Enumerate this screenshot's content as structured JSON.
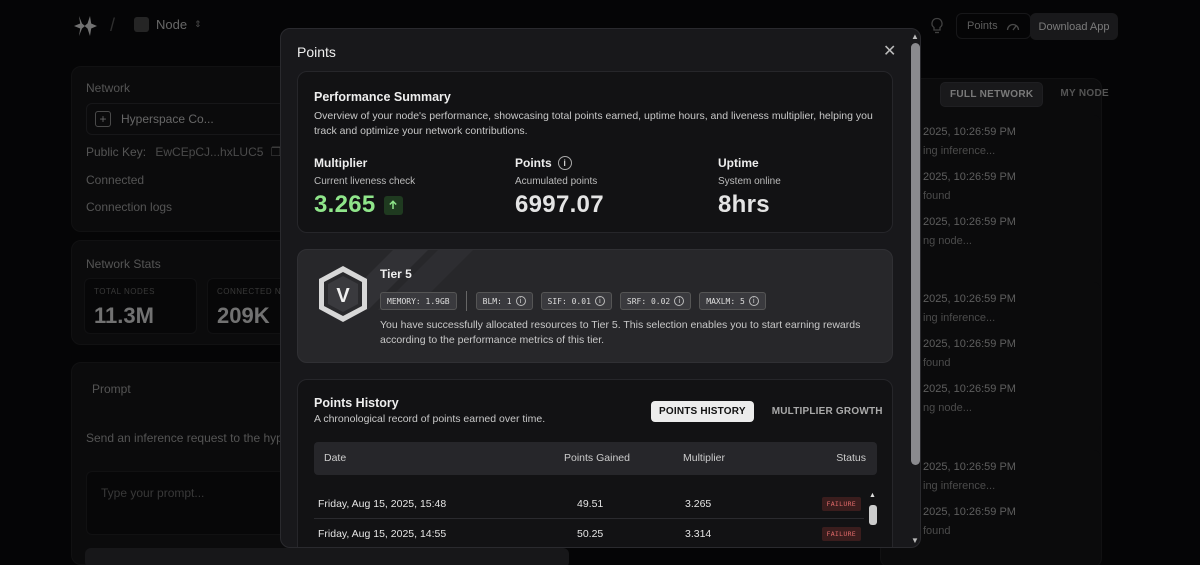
{
  "header": {
    "breadcrumb_node": "Node",
    "points_label": "Points",
    "download_label": "Download App"
  },
  "network": {
    "title": "Network",
    "hyperspace_label": "Hyperspace Co...",
    "public_key_label": "Public Key:",
    "public_key_value": "EwCEpCJ...hxLUC5",
    "status": "Connected",
    "logs_label": "Connection logs"
  },
  "stats": {
    "title": "Network Stats",
    "total_nodes_label": "TOTAL NODES",
    "total_nodes_value": "11.3M",
    "connected_label": "CONNECTED NO",
    "connected_value": "209K"
  },
  "prompt": {
    "title": "Prompt",
    "subtitle": "Send an inference request to the hyp",
    "placeholder": "Type your prompt..."
  },
  "activity": {
    "tab_full": "FULL NETWORK",
    "tab_my": "MY NODE",
    "groups": [
      [
        {
          "ts": "2025, 10:26:59 PM",
          "msg": "ing inference..."
        },
        {
          "ts": "2025, 10:26:59 PM",
          "msg": "found"
        },
        {
          "ts": "2025, 10:26:59 PM",
          "msg": "ng node..."
        }
      ],
      [
        {
          "ts": "2025, 10:26:59 PM",
          "msg": "ing inference..."
        },
        {
          "ts": "2025, 10:26:59 PM",
          "msg": "found"
        },
        {
          "ts": "2025, 10:26:59 PM",
          "msg": "ng node..."
        }
      ],
      [
        {
          "ts": "2025, 10:26:59 PM",
          "msg": "ing inference..."
        },
        {
          "ts": "2025, 10:26:59 PM",
          "msg": "found"
        }
      ]
    ]
  },
  "modal": {
    "title": "Points",
    "summary": {
      "title": "Performance Summary",
      "description": "Overview of your node's performance, showcasing total points earned, uptime hours, and liveness multiplier, helping you track and optimize your network contributions.",
      "multiplier": {
        "label": "Multiplier",
        "sub": "Current liveness check",
        "value": "3.265"
      },
      "points": {
        "label": "Points",
        "sub": "Acumulated points",
        "value": "6997.07"
      },
      "uptime": {
        "label": "Uptime",
        "sub": "System online",
        "value": "8hrs"
      }
    },
    "tier": {
      "title": "Tier 5",
      "logo_letter": "V",
      "badges": [
        "MEMORY: 1.9GB",
        "BLM: 1",
        "SIF: 0.01",
        "SRF: 0.02",
        "MAXLM: 5"
      ],
      "description": "You have successfully allocated resources to Tier 5. This selection enables you to start earning rewards according to the performance metrics of this tier."
    },
    "history": {
      "title": "Points History",
      "description": "A chronological record of points earned over time.",
      "tab_points": "POINTS HISTORY",
      "tab_growth": "MULTIPLIER GROWTH",
      "columns": [
        "Date",
        "Points Gained",
        "Multiplier",
        "Status"
      ],
      "rows": [
        {
          "date": "Friday, Aug 15, 2025, 15:48",
          "points": "49.51",
          "multiplier": "3.265",
          "status": "FAILURE"
        },
        {
          "date": "Friday, Aug 15, 2025, 14:55",
          "points": "50.25",
          "multiplier": "3.314",
          "status": "FAILURE"
        }
      ]
    }
  },
  "colors": {
    "accent_green": "#8fe58a",
    "failure_red": "#e06a6a",
    "modal_bg": "#18181b"
  }
}
